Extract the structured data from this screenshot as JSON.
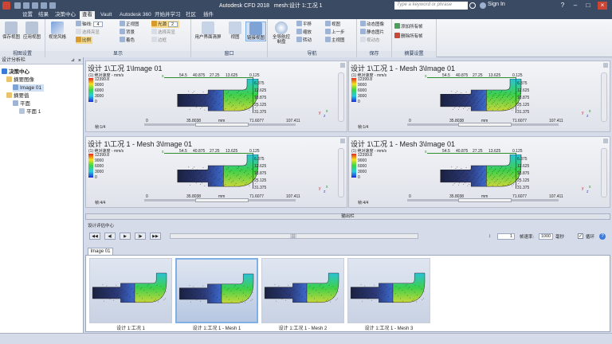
{
  "app": {
    "title": "Autodesk CFD 2018",
    "document": "mesh:设计 1:工况 1",
    "search_placeholder": "Type a keyword or phrase",
    "signin": "Sign In"
  },
  "menu": {
    "tabs": [
      "设置",
      "结果",
      "决策中心",
      "查看",
      "Vault",
      "Autodesk 360",
      "开始并学习",
      "社区",
      "插件"
    ],
    "active_tab": "查看"
  },
  "ribbon": {
    "panels": [
      {
        "label": "视图设置",
        "buttons": [
          "保存视图",
          "应用视图"
        ]
      },
      {
        "label": "显示",
        "items": [
          "轴线:",
          "选择亮显",
          "比例",
          "视觉风格",
          "正视图",
          "背景",
          "光源",
          "选择亮显",
          "轴线",
          "渲染",
          "显示缩略",
          "边框",
          "着色"
        ],
        "axis_value": "4",
        "light_value": "2"
      },
      {
        "label": "窗口",
        "buttons": [
          "用户界面",
          "清屏",
          "视图",
          "链接视图"
        ]
      },
      {
        "label": "导航",
        "items": [
          "全导航控制盘",
          "平移",
          "缩放",
          "转动",
          "视图",
          "上一步",
          "主视图"
        ]
      },
      {
        "label": "保存",
        "items": [
          "动态图像",
          "静态图片",
          "视动态"
        ]
      },
      {
        "label": "摘要设置",
        "items": [
          "添加所有帧",
          "删除所有帧"
        ]
      }
    ]
  },
  "tree": {
    "header": "设计分析栏",
    "root": "决策中心",
    "group1": "摘要图像",
    "image": "Image 01",
    "group2": "摘要值",
    "plane_group": "平面",
    "plane": "平面 1"
  },
  "views": [
    {
      "title": "设计 1\\工况 1\\Image 01",
      "frame": "帧:1/4"
    },
    {
      "title": "设计 1\\工况 1 - Mesh 3\\Image 01",
      "frame": "帧:1/4"
    },
    {
      "title": "设计 1\\工况 1 - Mesh 3\\Image 01",
      "frame": "帧:4/4"
    },
    {
      "title": "设计 1\\工况 1 - Mesh 3\\Image 01",
      "frame": "帧:4/4"
    }
  ],
  "view_common": {
    "legend_title": "(1) 绝对速度 - mm/s",
    "legend_values": [
      "12399.8",
      "9000",
      "6000",
      "3000",
      "0"
    ],
    "top_ticks": [
      "54.5",
      "40.875",
      "27.25",
      "13.625",
      "0.125"
    ],
    "right_ticks": [
      "6.375",
      "12.625",
      "18.875",
      "25.125",
      "31.375"
    ],
    "bottom_ticks": [
      "0",
      "35.8038",
      "mm",
      "71.6077",
      "107.411"
    ],
    "axis_x": "x",
    "axis_y": "y",
    "axis_z": "z"
  },
  "output_panel": {
    "label": "输出栏"
  },
  "controls": {
    "label": "设计评估中心",
    "buttons": [
      "◀◀",
      "◀|",
      "▶",
      "|▶",
      "▶▶"
    ],
    "frame_value": "1",
    "fps_label": "帧速率:",
    "fps_value": "1000",
    "fps_unit": "毫秒",
    "loop_label": "循环",
    "loop_checked": "✓"
  },
  "gallery": {
    "tab": "Image 01",
    "items": [
      "设计 1:工况 1",
      "设计 1:工况 1 - Mesh 1",
      "设计 1:工况 1 - Mesh 2",
      "设计 1:工况 1 - Mesh 3"
    ]
  },
  "colors": {
    "accent": "#3b4a63",
    "selection": "#cfe0f7"
  }
}
